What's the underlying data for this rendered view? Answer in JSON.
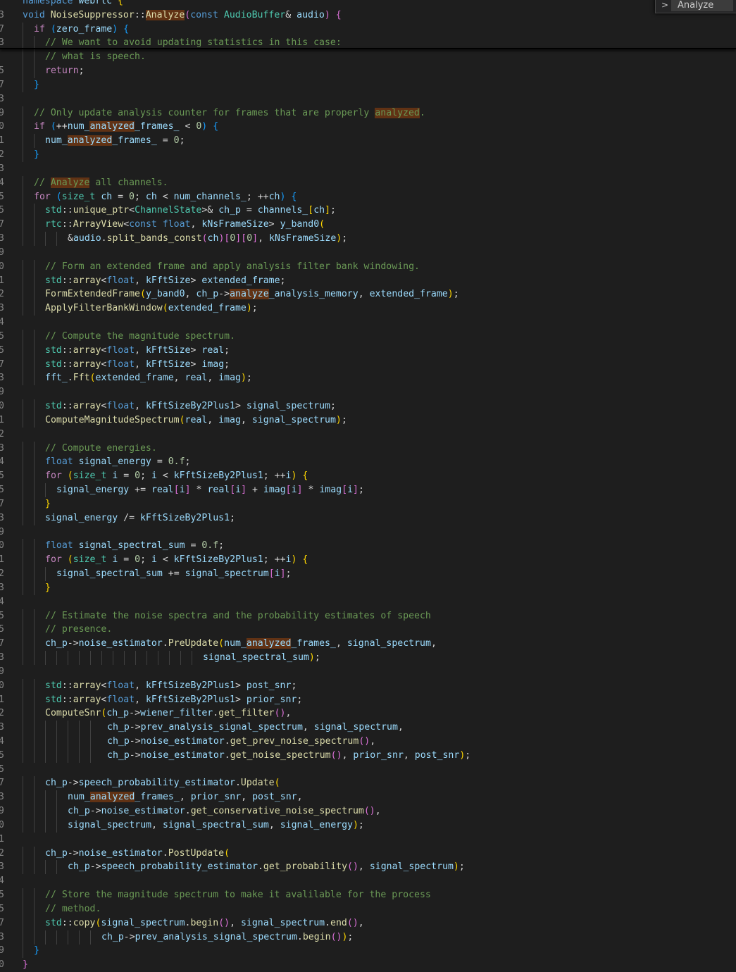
{
  "editor": {
    "find_query": "Analyze",
    "lines": [
      {
        "ln": "",
        "t": "namespace webrtc {",
        "i": 0
      },
      {
        "ln": "3",
        "t": "void NoiseSuppressor::Analyze(const AudioBuffer& audio) {",
        "i": 0
      },
      {
        "ln": "7",
        "t": "if (zero_frame) {",
        "i": 1
      },
      {
        "ln": "3",
        "t": "// We want to avoid updating statistics in this case:",
        "i": 2
      },
      {
        "ln": "",
        "t": "// what is speech.",
        "i": 2
      },
      {
        "ln": "5",
        "t": "return;",
        "i": 2
      },
      {
        "ln": "7",
        "t": "}",
        "i": 1
      },
      {
        "ln": "3",
        "t": "",
        "i": 0
      },
      {
        "ln": "9",
        "t": "// Only update analysis counter for frames that are properly analyzed.",
        "i": 1
      },
      {
        "ln": "0",
        "t": "if (++num_analyzed_frames_ < 0) {",
        "i": 1
      },
      {
        "ln": "1",
        "t": "num_analyzed_frames_ = 0;",
        "i": 2
      },
      {
        "ln": "2",
        "t": "}",
        "i": 1
      },
      {
        "ln": "3",
        "t": "",
        "i": 0
      },
      {
        "ln": "4",
        "t": "// Analyze all channels.",
        "i": 1
      },
      {
        "ln": "5",
        "t": "for (size_t ch = 0; ch < num_channels_; ++ch) {",
        "i": 1
      },
      {
        "ln": "5",
        "t": "std::unique_ptr<ChannelState>& ch_p = channels_[ch];",
        "i": 2
      },
      {
        "ln": "7",
        "t": "rtc::ArrayView<const float, kNsFrameSize> y_band0(",
        "i": 2
      },
      {
        "ln": "3",
        "t": "&audio.split_bands_const(ch)[0][0], kNsFrameSize);",
        "i": 4
      },
      {
        "ln": "9",
        "t": "",
        "i": 0
      },
      {
        "ln": "0",
        "t": "// Form an extended frame and apply analysis filter bank windowing.",
        "i": 2
      },
      {
        "ln": "1",
        "t": "std::array<float, kFftSize> extended_frame;",
        "i": 2
      },
      {
        "ln": "2",
        "t": "FormExtendedFrame(y_band0, ch_p->analyze_analysis_memory, extended_frame);",
        "i": 2
      },
      {
        "ln": "3",
        "t": "ApplyFilterBankWindow(extended_frame);",
        "i": 2
      },
      {
        "ln": "4",
        "t": "",
        "i": 0
      },
      {
        "ln": "5",
        "t": "// Compute the magnitude spectrum.",
        "i": 2
      },
      {
        "ln": "5",
        "t": "std::array<float, kFftSize> real;",
        "i": 2
      },
      {
        "ln": "7",
        "t": "std::array<float, kFftSize> imag;",
        "i": 2
      },
      {
        "ln": "3",
        "t": "fft_.Fft(extended_frame, real, imag);",
        "i": 2
      },
      {
        "ln": "9",
        "t": "",
        "i": 0
      },
      {
        "ln": "0",
        "t": "std::array<float, kFftSizeBy2Plus1> signal_spectrum;",
        "i": 2
      },
      {
        "ln": "1",
        "t": "ComputeMagnitudeSpectrum(real, imag, signal_spectrum);",
        "i": 2
      },
      {
        "ln": "2",
        "t": "",
        "i": 0
      },
      {
        "ln": "3",
        "t": "// Compute energies.",
        "i": 2
      },
      {
        "ln": "4",
        "t": "float signal_energy = 0.f;",
        "i": 2
      },
      {
        "ln": "5",
        "t": "for (size_t i = 0; i < kFftSizeBy2Plus1; ++i) {",
        "i": 2
      },
      {
        "ln": "5",
        "t": "signal_energy += real[i] * real[i] + imag[i] * imag[i];",
        "i": 3
      },
      {
        "ln": "7",
        "t": "}",
        "i": 2
      },
      {
        "ln": "3",
        "t": "signal_energy /= kFftSizeBy2Plus1;",
        "i": 2
      },
      {
        "ln": "9",
        "t": "",
        "i": 0
      },
      {
        "ln": "0",
        "t": "float signal_spectral_sum = 0.f;",
        "i": 2
      },
      {
        "ln": "1",
        "t": "for (size_t i = 0; i < kFftSizeBy2Plus1; ++i) {",
        "i": 2
      },
      {
        "ln": "2",
        "t": "signal_spectral_sum += signal_spectrum[i];",
        "i": 3
      },
      {
        "ln": "3",
        "t": "}",
        "i": 2
      },
      {
        "ln": "4",
        "t": "",
        "i": 0
      },
      {
        "ln": "5",
        "t": "// Estimate the noise spectra and the probability estimates of speech",
        "i": 2
      },
      {
        "ln": "5",
        "t": "// presence.",
        "i": 2
      },
      {
        "ln": "7",
        "t": "ch_p->noise_estimator.PreUpdate(num_analyzed_frames_, signal_spectrum,",
        "i": 2
      },
      {
        "ln": "3",
        "t": "signal_spectral_sum);",
        "i": 16
      },
      {
        "ln": "9",
        "t": "",
        "i": 0
      },
      {
        "ln": "0",
        "t": "std::array<float, kFftSizeBy2Plus1> post_snr;",
        "i": 2
      },
      {
        "ln": "1",
        "t": "std::array<float, kFftSizeBy2Plus1> prior_snr;",
        "i": 2
      },
      {
        "ln": "2",
        "t": "ComputeSnr(ch_p->wiener_filter.get_filter(),",
        "i": 2
      },
      {
        "ln": "3",
        "t": "ch_p->prev_analysis_signal_spectrum, signal_spectrum,",
        "i": 7.5
      },
      {
        "ln": "4",
        "t": "ch_p->noise_estimator.get_prev_noise_spectrum(),",
        "i": 7.5
      },
      {
        "ln": "5",
        "t": "ch_p->noise_estimator.get_noise_spectrum(), prior_snr, post_snr);",
        "i": 7.5
      },
      {
        "ln": "5",
        "t": "",
        "i": 0
      },
      {
        "ln": "7",
        "t": "ch_p->speech_probability_estimator.Update(",
        "i": 2
      },
      {
        "ln": "3",
        "t": "num_analyzed_frames_, prior_snr, post_snr,",
        "i": 4
      },
      {
        "ln": "9",
        "t": "ch_p->noise_estimator.get_conservative_noise_spectrum(),",
        "i": 4
      },
      {
        "ln": "0",
        "t": "signal_spectrum, signal_spectral_sum, signal_energy);",
        "i": 4
      },
      {
        "ln": "1",
        "t": "",
        "i": 0
      },
      {
        "ln": "2",
        "t": "ch_p->noise_estimator.PostUpdate(",
        "i": 2
      },
      {
        "ln": "3",
        "t": "ch_p->speech_probability_estimator.get_probability(), signal_spectrum);",
        "i": 4
      },
      {
        "ln": "4",
        "t": "",
        "i": 0
      },
      {
        "ln": "5",
        "t": "// Store the magnitude spectrum to make it avalilable for the process",
        "i": 2
      },
      {
        "ln": "5",
        "t": "// method.",
        "i": 2
      },
      {
        "ln": "7",
        "t": "std::copy(signal_spectrum.begin(), signal_spectrum.end(),",
        "i": 2
      },
      {
        "ln": "3",
        "t": "ch_p->prev_analysis_signal_spectrum.begin());",
        "i": 7
      },
      {
        "ln": "9",
        "t": "}",
        "i": 1
      },
      {
        "ln": "0",
        "t": "}",
        "i": 0
      }
    ]
  },
  "theme": {
    "background": "#1e1e1e",
    "keyword": "#569cd6",
    "control": "#c586c0",
    "type": "#4ec9b0",
    "function": "#dcdcaa",
    "variable": "#9cdcfe",
    "number": "#b5cea8",
    "comment": "#6a9955",
    "match_highlight": "#613214",
    "line_number": "#858585"
  }
}
